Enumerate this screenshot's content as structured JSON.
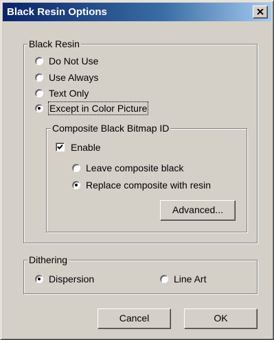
{
  "window": {
    "title": "Black Resin Options",
    "close_icon": "close-icon"
  },
  "black_resin": {
    "legend": "Black Resin",
    "options": [
      {
        "label": "Do Not Use",
        "checked": false
      },
      {
        "label": "Use Always",
        "checked": false
      },
      {
        "label": "Text Only",
        "checked": false
      },
      {
        "label": "Except in Color Picture",
        "checked": true
      }
    ]
  },
  "composite": {
    "legend": "Composite Black Bitmap ID",
    "enable_label": "Enable",
    "enable_checked": true,
    "options": [
      {
        "label": "Leave composite black",
        "checked": false
      },
      {
        "label": "Replace composite with resin",
        "checked": true
      }
    ],
    "advanced_label": "Advanced..."
  },
  "dithering": {
    "legend": "Dithering",
    "options": [
      {
        "label": "Dispersion",
        "checked": true
      },
      {
        "label": "Line Art",
        "checked": false
      }
    ]
  },
  "buttons": {
    "cancel": "Cancel",
    "ok": "OK"
  }
}
